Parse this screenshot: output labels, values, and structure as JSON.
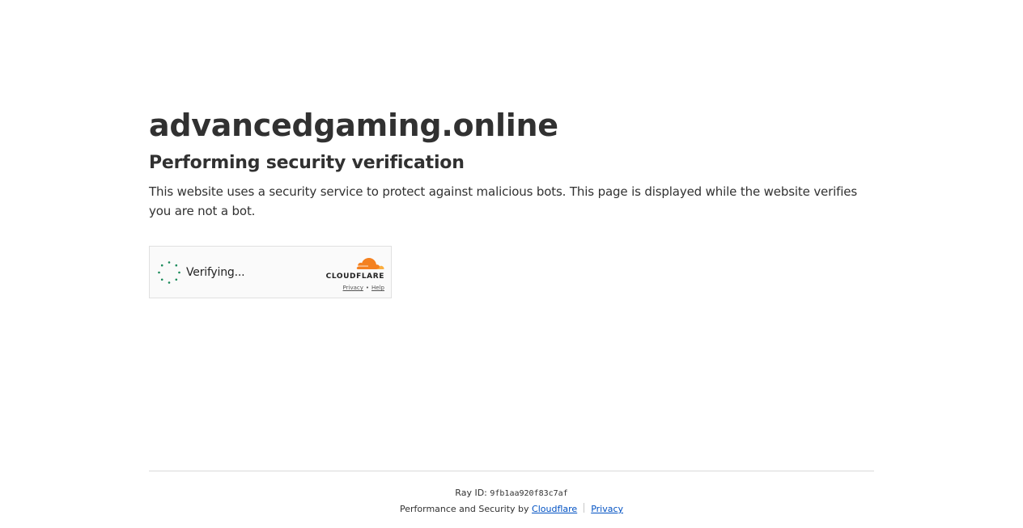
{
  "page": {
    "site_title": "advancedgaming.online",
    "subtitle": "Performing security verification",
    "description": "This website uses a security service to protect against malicious bots. This page is displayed while the website verifies you are not a bot."
  },
  "widget": {
    "status_text": "Verifying...",
    "spinner_icon": "loading-spinner-icon",
    "spinner_color": "#1a8a5a",
    "brand": "CLOUDFLARE",
    "brand_color": "#f48120",
    "privacy_link": "Privacy",
    "link_separator": "•",
    "help_link": "Help"
  },
  "footer": {
    "ray_label": "Ray ID:",
    "ray_id": "9fb1aa920f83c7af",
    "perf_prefix": "Performance and Security by",
    "cloudflare_link": "Cloudflare",
    "privacy_link": "Privacy",
    "link_color": "#0051c3"
  }
}
